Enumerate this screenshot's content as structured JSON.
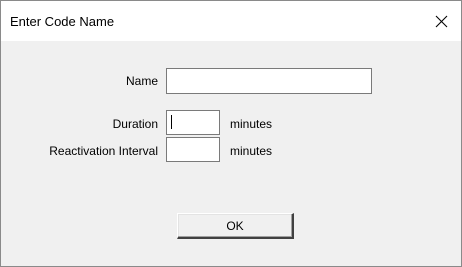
{
  "window": {
    "title": "Enter Code Name",
    "close_icon": "close-icon"
  },
  "form": {
    "name_label": "Name",
    "name_value": "",
    "duration_label": "Duration",
    "duration_value": "",
    "duration_unit": "minutes",
    "reactivation_label": "Reactivation Interval",
    "reactivation_value": "",
    "reactivation_unit": "minutes"
  },
  "buttons": {
    "ok_label": "OK"
  }
}
